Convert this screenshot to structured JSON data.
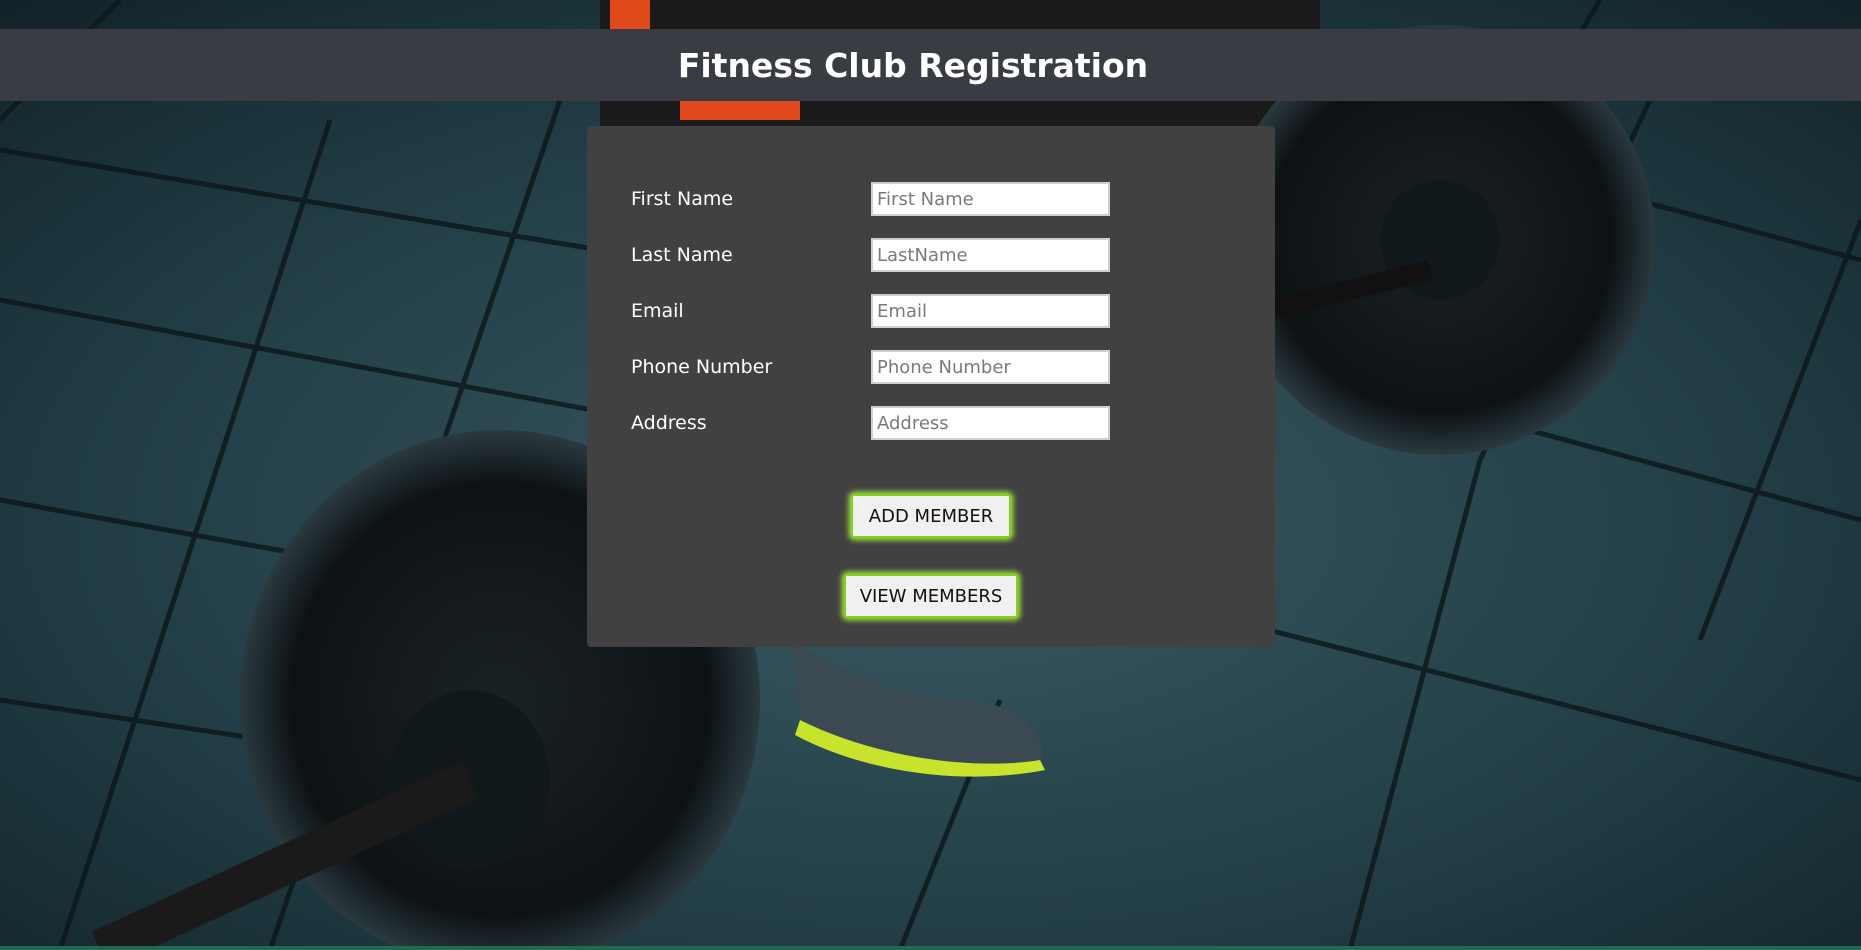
{
  "header": {
    "title": "Fitness Club Registration"
  },
  "form": {
    "fields": [
      {
        "label": "First Name",
        "placeholder": "First Name",
        "value": ""
      },
      {
        "label": "Last Name",
        "placeholder": "LastName",
        "value": ""
      },
      {
        "label": "Email",
        "placeholder": "Email",
        "value": ""
      },
      {
        "label": "Phone Number",
        "placeholder": "Phone Number",
        "value": ""
      },
      {
        "label": "Address",
        "placeholder": "Address",
        "value": ""
      }
    ],
    "add_button": "ADD MEMBER",
    "view_button": "VIEW MEMBERS"
  },
  "colors": {
    "header_bg": "#393c42",
    "card_bg": "#414141",
    "button_glow": "#a8f03a"
  },
  "background": {
    "icon": "gym-deadlift-photo"
  }
}
